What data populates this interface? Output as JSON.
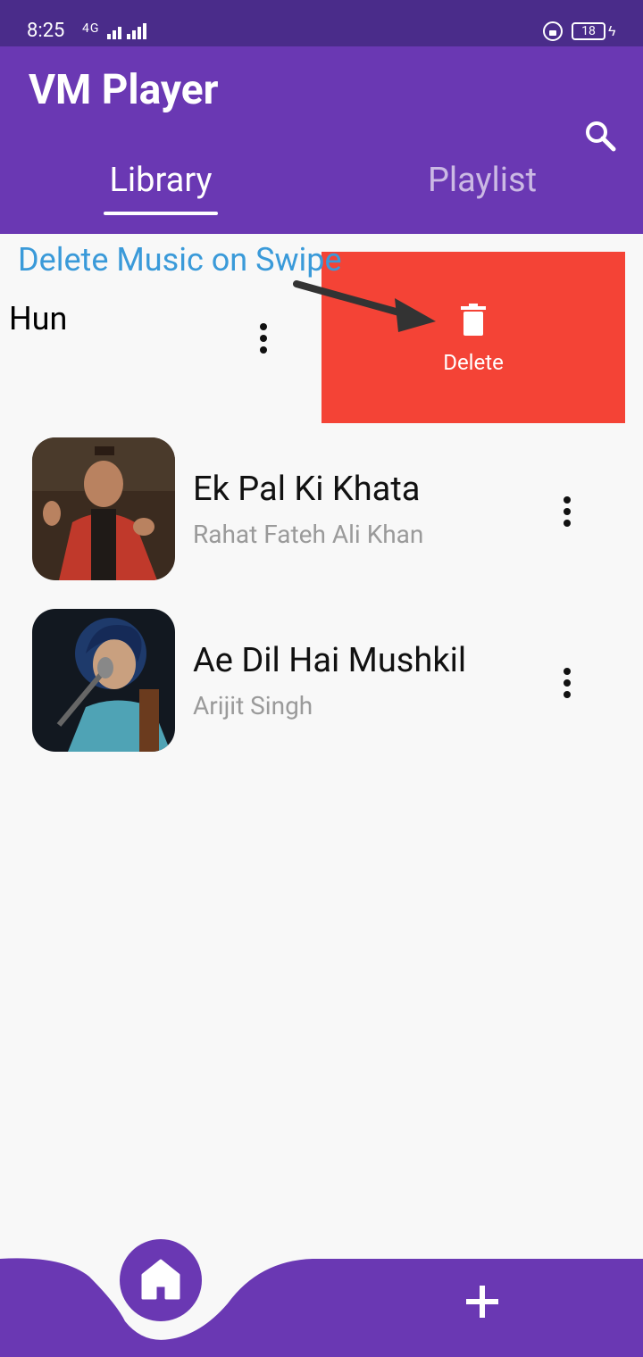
{
  "status_bar": {
    "time": "8:25",
    "network": "4G",
    "battery": "18"
  },
  "app": {
    "title": "VM Player"
  },
  "tabs": [
    {
      "label": "Library",
      "active": true
    },
    {
      "label": "Playlist",
      "active": false
    }
  ],
  "annotation": {
    "caption": "Delete Music on Swipe"
  },
  "swiped_item": {
    "title": "Hun",
    "action_label": "Delete"
  },
  "tracks": [
    {
      "title": "Ek Pal Ki Khata",
      "artist": "Rahat Fateh Ali Khan"
    },
    {
      "title": "Ae Dil Hai Mushkil",
      "artist": "Arijit Singh"
    }
  ],
  "colors": {
    "primary": "#6a38b3",
    "status": "#4a2c8a",
    "danger": "#f44336",
    "caption": "#3a9ad9"
  },
  "icons": {
    "search": "search-icon",
    "trash": "trash-icon",
    "more": "more-vert-icon",
    "home": "home-icon",
    "add": "plus-icon"
  }
}
